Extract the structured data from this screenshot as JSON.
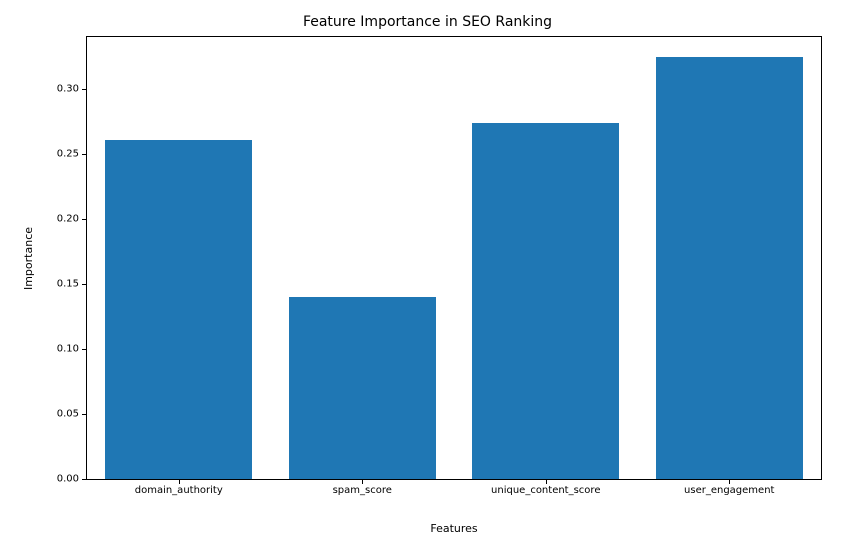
{
  "chart_data": {
    "type": "bar",
    "title": "Feature Importance in SEO Ranking",
    "xlabel": "Features",
    "ylabel": "Importance",
    "categories": [
      "domain_authority",
      "spam_score",
      "unique_content_score",
      "user_engagement"
    ],
    "values": [
      0.261,
      0.14,
      0.274,
      0.325
    ],
    "ylim": [
      0.0,
      0.34
    ],
    "yticks": [
      0.0,
      0.05,
      0.1,
      0.15,
      0.2,
      0.25,
      0.3
    ],
    "ytick_labels": [
      "0.00",
      "0.05",
      "0.10",
      "0.15",
      "0.20",
      "0.25",
      "0.30"
    ],
    "bar_color": "#1f77b4"
  }
}
